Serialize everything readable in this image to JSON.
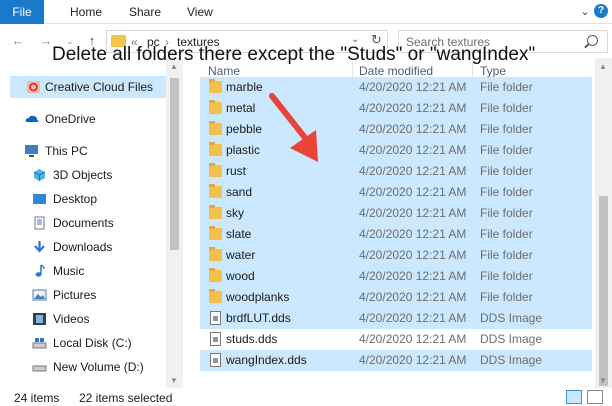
{
  "ribbon": {
    "file": "File",
    "tabs": [
      "Home",
      "Share",
      "View"
    ]
  },
  "address": {
    "crumbs": [
      "«",
      "pc",
      "›",
      "textures"
    ]
  },
  "search": {
    "placeholder": "Search textures"
  },
  "annotation": "Delete all folders there except the \"Studs\" or \"wangIndex\"",
  "nav": {
    "items": [
      {
        "label": "Creative Cloud Files",
        "icon": "creative-cloud-icon",
        "selected": true
      },
      {
        "label": "OneDrive",
        "icon": "onedrive-icon"
      },
      {
        "label": "This PC",
        "icon": "computer-icon"
      },
      {
        "label": "3D Objects",
        "icon": "cube-icon"
      },
      {
        "label": "Desktop",
        "icon": "desktop-icon"
      },
      {
        "label": "Documents",
        "icon": "documents-icon"
      },
      {
        "label": "Downloads",
        "icon": "download-icon"
      },
      {
        "label": "Music",
        "icon": "music-icon"
      },
      {
        "label": "Pictures",
        "icon": "pictures-icon"
      },
      {
        "label": "Videos",
        "icon": "videos-icon"
      },
      {
        "label": "Local Disk (C:)",
        "icon": "drive-icon"
      },
      {
        "label": "New Volume (D:)",
        "icon": "drive-icon"
      }
    ]
  },
  "columns": {
    "name": "Name",
    "date": "Date modified",
    "type": "Type"
  },
  "files": [
    {
      "name": "marble",
      "date": "4/20/2020 12:21 AM",
      "type": "File folder",
      "kind": "folder",
      "selected": true
    },
    {
      "name": "metal",
      "date": "4/20/2020 12:21 AM",
      "type": "File folder",
      "kind": "folder",
      "selected": true
    },
    {
      "name": "pebble",
      "date": "4/20/2020 12:21 AM",
      "type": "File folder",
      "kind": "folder",
      "selected": true
    },
    {
      "name": "plastic",
      "date": "4/20/2020 12:21 AM",
      "type": "File folder",
      "kind": "folder",
      "selected": true
    },
    {
      "name": "rust",
      "date": "4/20/2020 12:21 AM",
      "type": "File folder",
      "kind": "folder",
      "selected": true
    },
    {
      "name": "sand",
      "date": "4/20/2020 12:21 AM",
      "type": "File folder",
      "kind": "folder",
      "selected": true
    },
    {
      "name": "sky",
      "date": "4/20/2020 12:21 AM",
      "type": "File folder",
      "kind": "folder",
      "selected": true
    },
    {
      "name": "slate",
      "date": "4/20/2020 12:21 AM",
      "type": "File folder",
      "kind": "folder",
      "selected": true
    },
    {
      "name": "water",
      "date": "4/20/2020 12:21 AM",
      "type": "File folder",
      "kind": "folder",
      "selected": true
    },
    {
      "name": "wood",
      "date": "4/20/2020 12:21 AM",
      "type": "File folder",
      "kind": "folder",
      "selected": true
    },
    {
      "name": "woodplanks",
      "date": "4/20/2020 12:21 AM",
      "type": "File folder",
      "kind": "folder",
      "selected": true
    },
    {
      "name": "brdfLUT.dds",
      "date": "4/20/2020 12:21 AM",
      "type": "DDS Image",
      "kind": "dds",
      "selected": true
    },
    {
      "name": "studs.dds",
      "date": "4/20/2020 12:21 AM",
      "type": "DDS Image",
      "kind": "dds",
      "selected": false
    },
    {
      "name": "wangIndex.dds",
      "date": "4/20/2020 12:21 AM",
      "type": "DDS Image",
      "kind": "dds",
      "selected": true
    }
  ],
  "status": {
    "count": "24 items",
    "selected": "22 items selected"
  },
  "colors": {
    "accent": "#1979ca",
    "selection": "#cce8ff",
    "folder": "#f2c14b",
    "arrow": "#e8443a"
  }
}
